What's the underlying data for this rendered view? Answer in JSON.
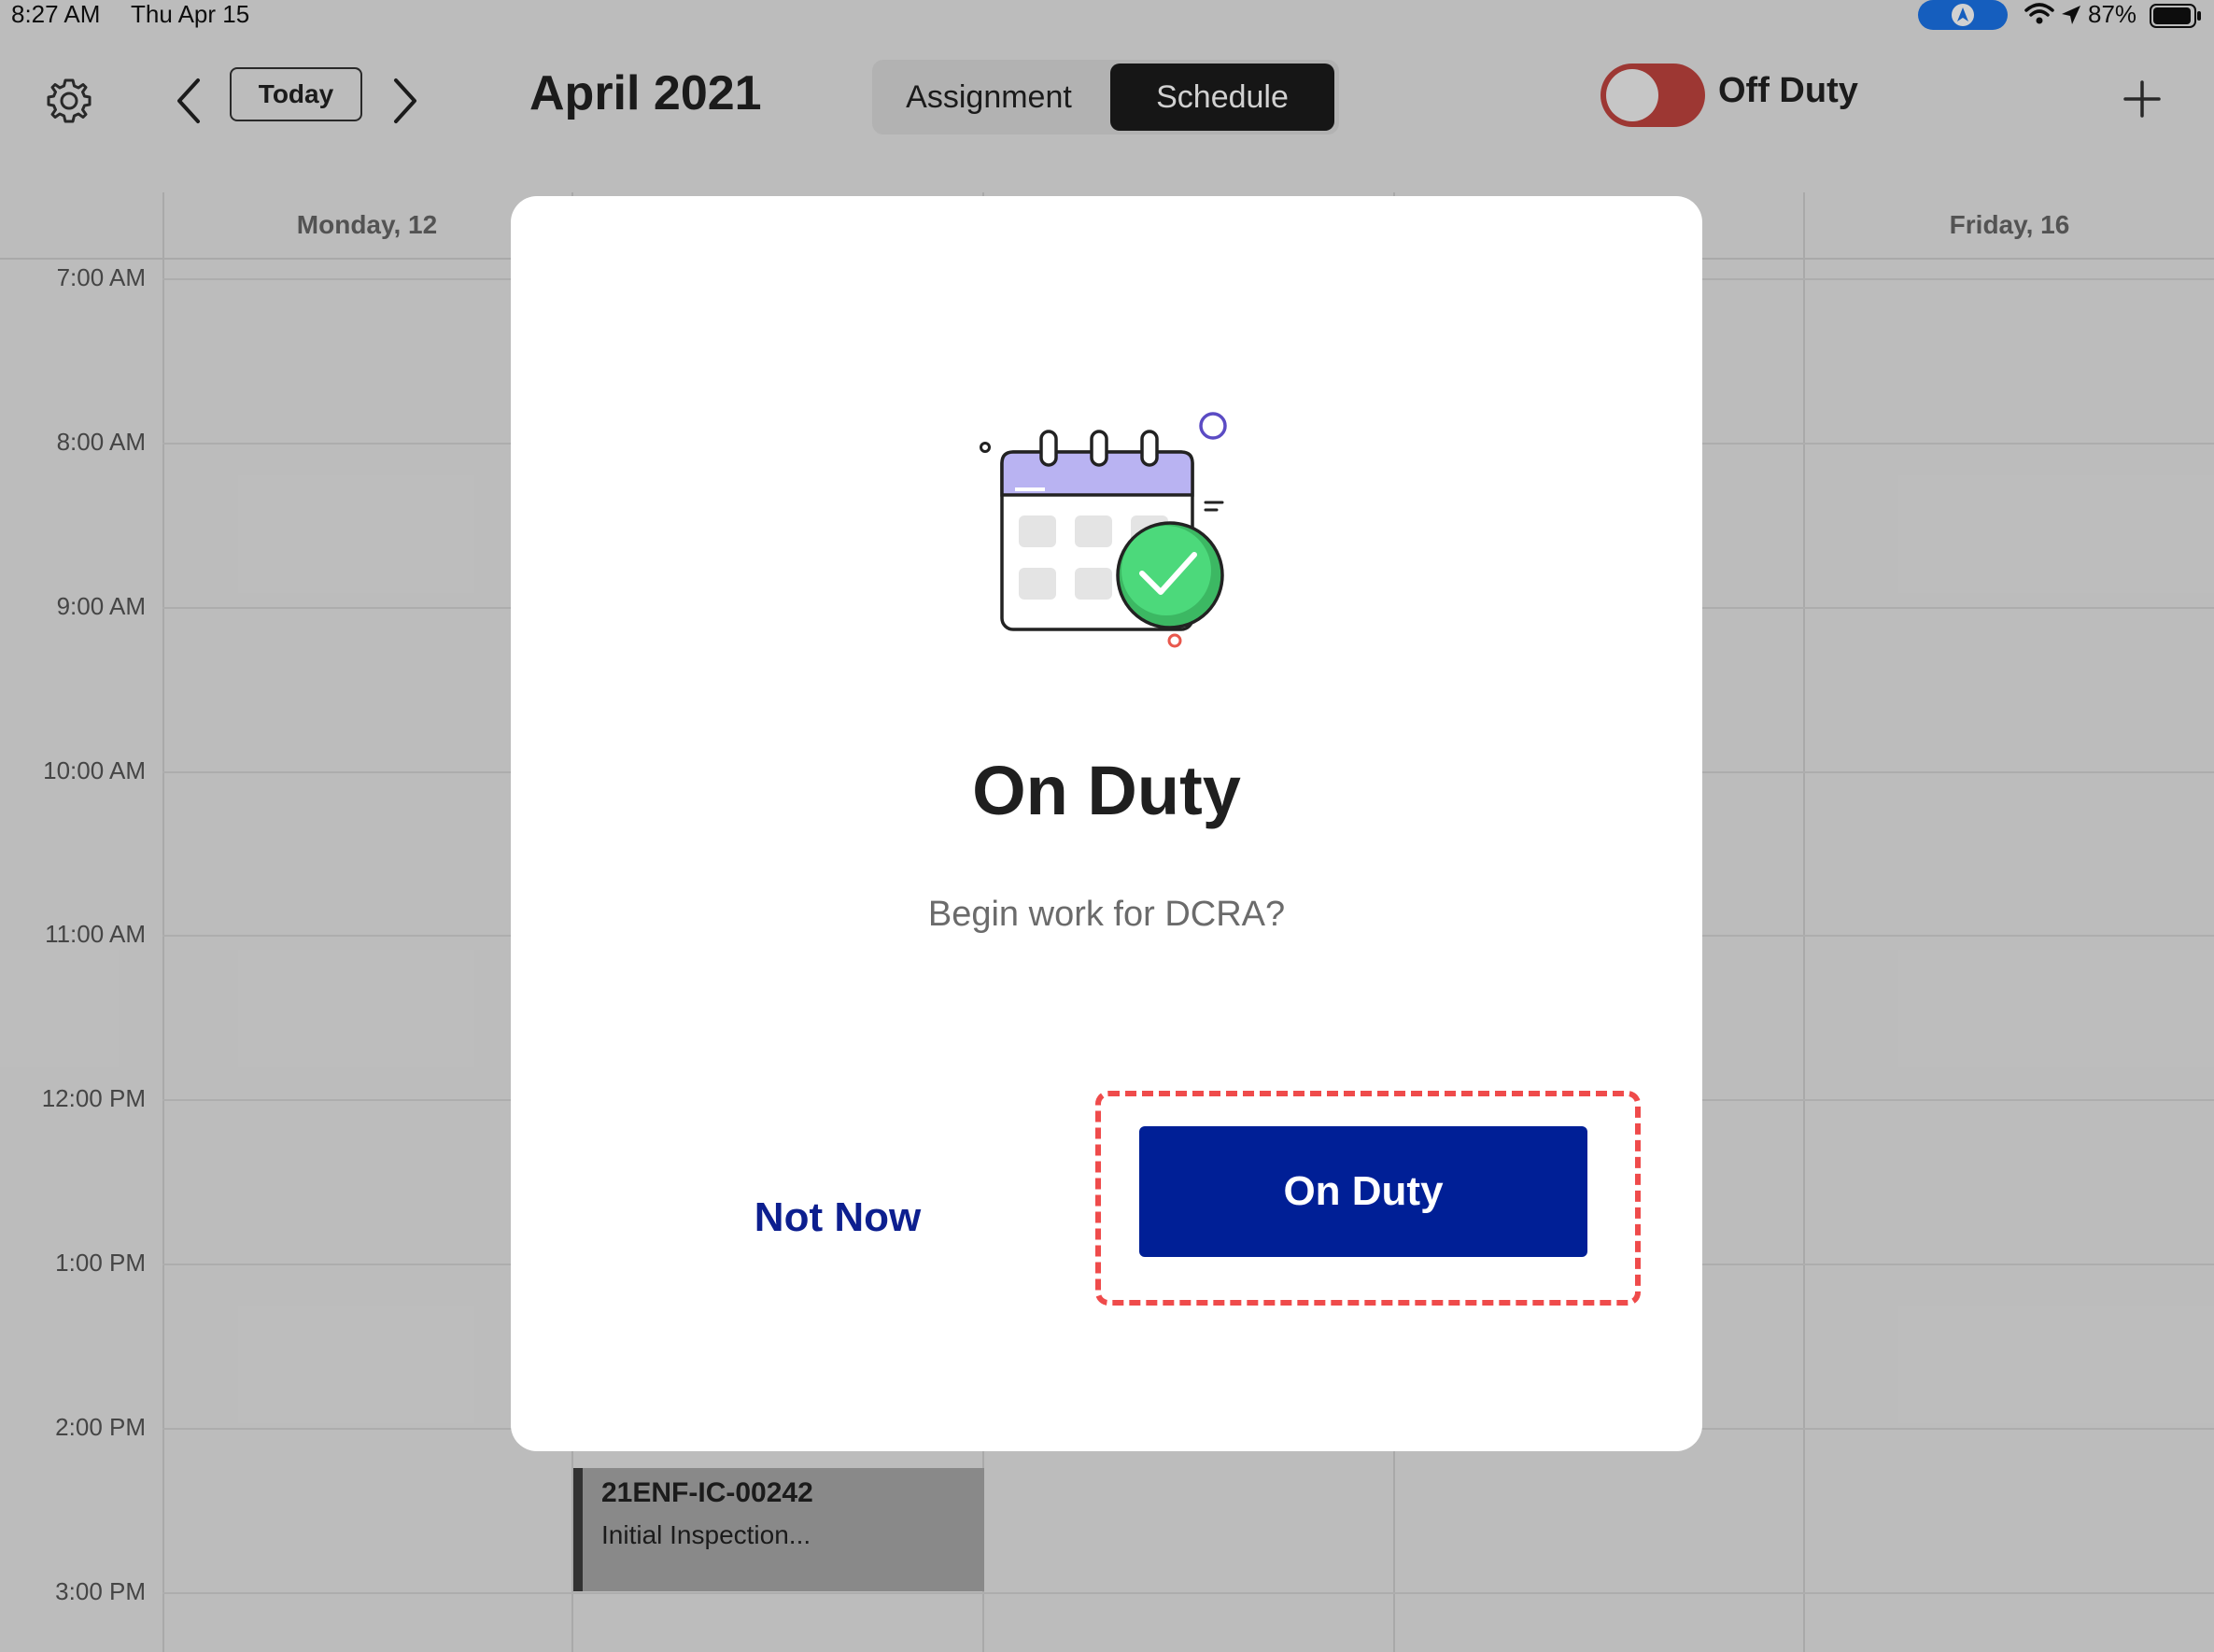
{
  "status_bar": {
    "time": "8:27 AM",
    "date": "Thu Apr 15",
    "battery_pct": "87%",
    "icons": [
      "location-pill-icon",
      "wifi-icon",
      "navigation-arrow-icon",
      "battery-icon"
    ]
  },
  "toolbar": {
    "settings_icon": "gear-icon",
    "prev_icon": "chevron-left-icon",
    "today_label": "Today",
    "next_icon": "chevron-right-icon",
    "month_title": "April 2021",
    "segments": {
      "assignment": "Assignment",
      "schedule": "Schedule",
      "selected": "Schedule"
    },
    "duty_label": "Off Duty",
    "duty_on": false,
    "add_icon": "plus-icon"
  },
  "calendar": {
    "days": [
      "Monday, 12",
      "Friday, 16"
    ],
    "hours": [
      "7:00 AM",
      "8:00 AM",
      "9:00 AM",
      "10:00 AM",
      "11:00 AM",
      "12:00 PM",
      "1:00 PM",
      "2:00 PM",
      "3:00 PM"
    ],
    "events": [
      {
        "id": "21ENF-IC-00242",
        "description": "Initial Inspection..."
      }
    ]
  },
  "modal": {
    "illustration_icon": "calendar-check-icon",
    "title": "On Duty",
    "subtitle": "Begin work for DCRA?",
    "secondary_button": "Not Now",
    "primary_button": "On Duty"
  },
  "colors": {
    "primary_button": "#001f96",
    "secondary_text": "#0d1f8f",
    "toggle_off": "#c0443f",
    "highlight": "#ef4b4b",
    "check_green": "#4cd97b",
    "calendar_header": "#b9b3f2"
  }
}
